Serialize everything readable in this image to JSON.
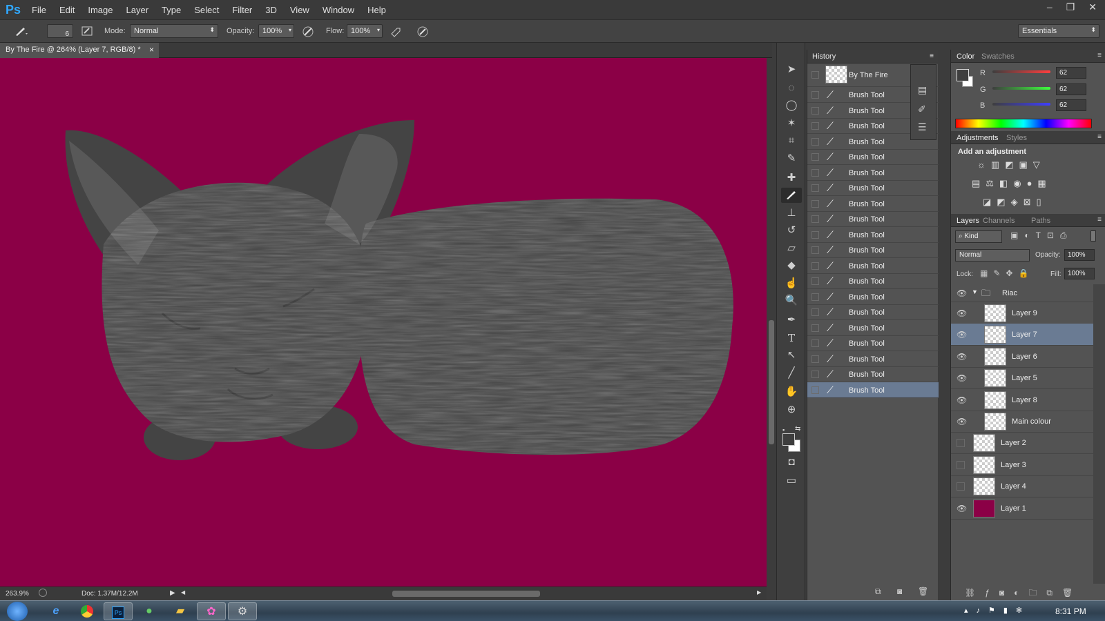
{
  "app": {
    "logo": "Ps"
  },
  "menu": [
    "File",
    "Edit",
    "Image",
    "Layer",
    "Type",
    "Select",
    "Filter",
    "3D",
    "View",
    "Window",
    "Help"
  ],
  "window_controls": {
    "minimize": "–",
    "restore": "❐",
    "close": "✕"
  },
  "options": {
    "brush_size": "6",
    "mode_label": "Mode:",
    "mode_value": "Normal",
    "opacity_label": "Opacity:",
    "opacity_value": "100%",
    "flow_label": "Flow:",
    "flow_value": "100%",
    "workspace": "Essentials"
  },
  "document": {
    "tab_title": "By The Fire @ 264% (Layer 7, RGB/8) *",
    "tab_close": "×",
    "zoom": "263.9%",
    "doc_size": "Doc: 1.37M/12.2M",
    "canvas_color": "#8b0046"
  },
  "history": {
    "title": "History",
    "snapshot": "By The Fire",
    "items": [
      "Brush Tool",
      "Brush Tool",
      "Brush Tool",
      "Brush Tool",
      "Brush Tool",
      "Brush Tool",
      "Brush Tool",
      "Brush Tool",
      "Brush Tool",
      "Brush Tool",
      "Brush Tool",
      "Brush Tool",
      "Brush Tool",
      "Brush Tool",
      "Brush Tool",
      "Brush Tool",
      "Brush Tool",
      "Brush Tool",
      "Brush Tool",
      "Brush Tool"
    ],
    "selected_index": 19
  },
  "color_panel": {
    "tabs": [
      "Color",
      "Swatches"
    ],
    "channels": [
      {
        "label": "R",
        "value": "62"
      },
      {
        "label": "G",
        "value": "62"
      },
      {
        "label": "B",
        "value": "62"
      }
    ]
  },
  "adjustments": {
    "tabs": [
      "Adjustments",
      "Styles"
    ],
    "heading": "Add an adjustment"
  },
  "layers_panel": {
    "tabs": [
      "Layers",
      "Channels",
      "Paths"
    ],
    "filter_kind": "Kind",
    "blend_mode": "Normal",
    "opacity_label": "Opacity:",
    "opacity_value": "100%",
    "lock_label": "Lock:",
    "fill_label": "Fill:",
    "fill_value": "100%",
    "group_name": "Riac",
    "layers": [
      {
        "name": "Layer 9",
        "visible": true,
        "in_group": true
      },
      {
        "name": "Layer 7",
        "visible": true,
        "in_group": true,
        "selected": true
      },
      {
        "name": "Layer 6",
        "visible": true,
        "in_group": true
      },
      {
        "name": "Layer 5",
        "visible": true,
        "in_group": true
      },
      {
        "name": "Layer 8",
        "visible": true,
        "in_group": true
      },
      {
        "name": "Main colour",
        "visible": true,
        "in_group": true
      },
      {
        "name": "Layer 2",
        "visible": false,
        "in_group": false
      },
      {
        "name": "Layer 3",
        "visible": false,
        "in_group": false
      },
      {
        "name": "Layer 4",
        "visible": false,
        "in_group": false
      },
      {
        "name": "Layer 1",
        "visible": true,
        "in_group": false,
        "fill": "#8b0046"
      }
    ]
  },
  "taskbar": {
    "clock": "8:31 PM",
    "apps": [
      "ie-icon",
      "chrome-icon",
      "photoshop-icon",
      "messenger-icon",
      "explorer-icon",
      "paint-icon",
      "app-icon"
    ]
  }
}
